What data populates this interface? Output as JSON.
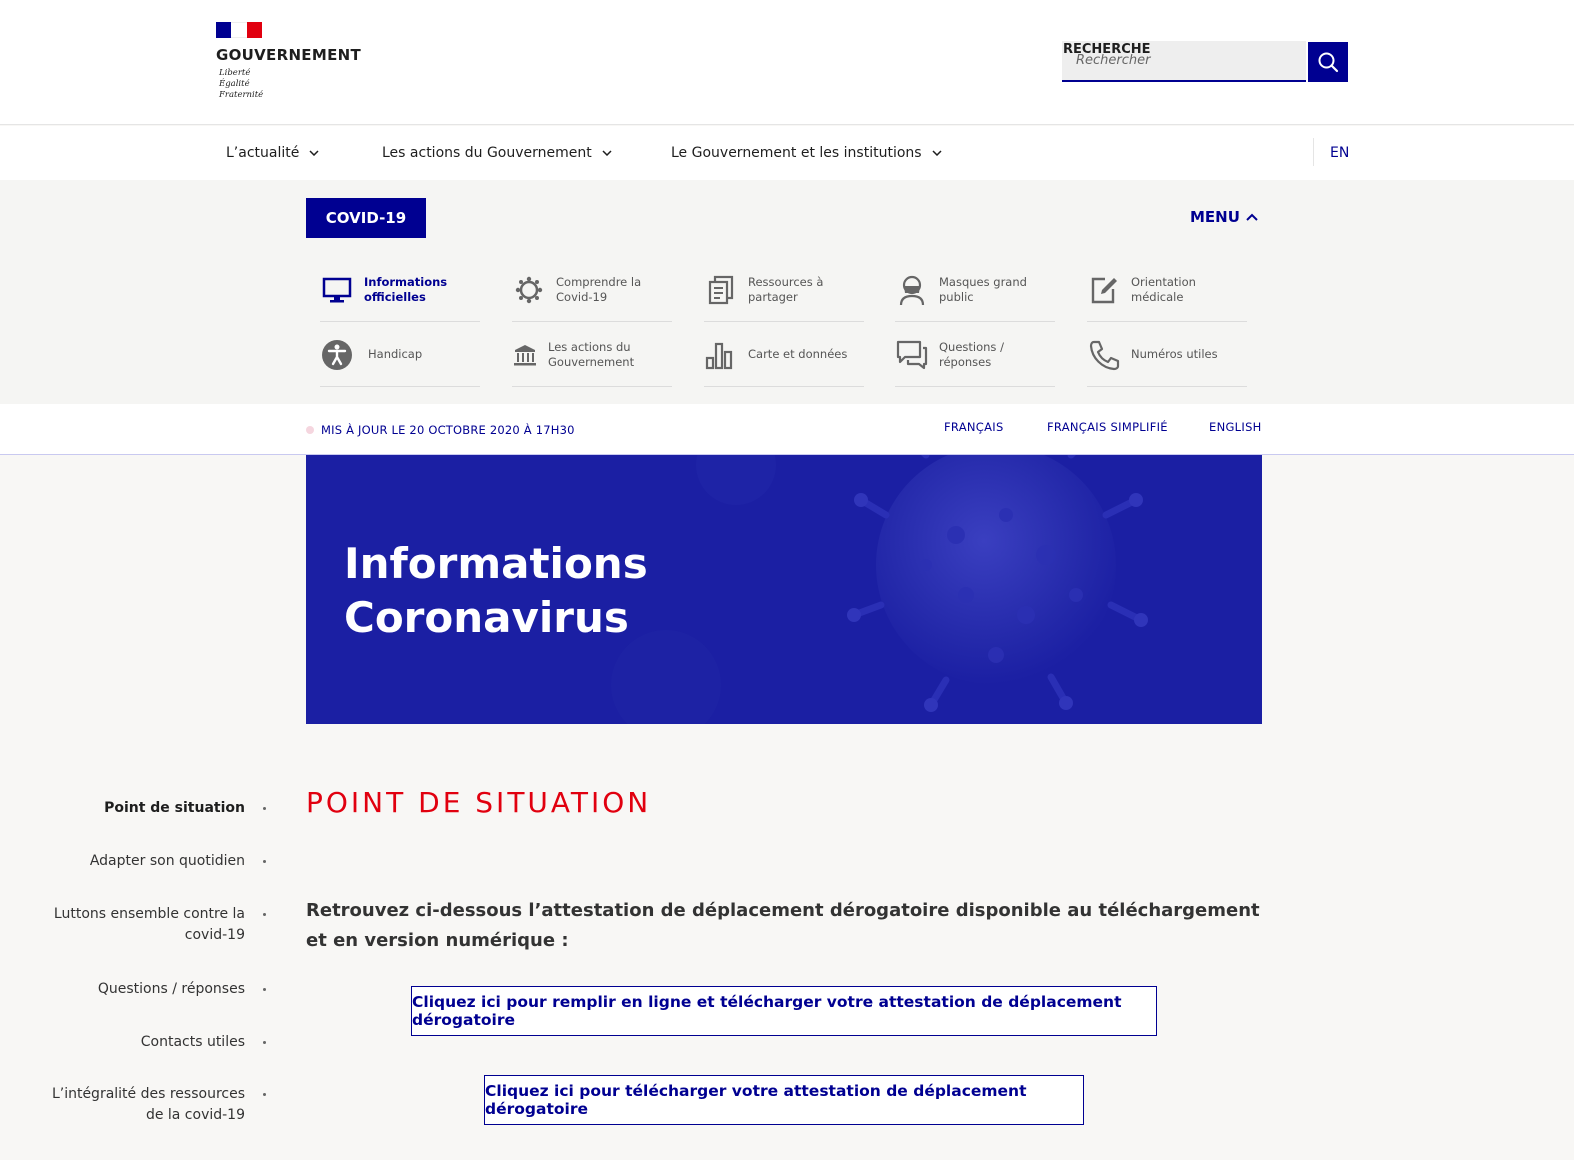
{
  "header": {
    "gov_name": "GOUVERNEMENT",
    "motto": [
      "Liberté",
      "Égalité",
      "Fraternité"
    ],
    "search_label": "RECHERCHE",
    "search_placeholder": "Rechercher",
    "search_button_icon": "search-icon"
  },
  "nav": {
    "items": [
      {
        "label": "L’actualité"
      },
      {
        "label": "Les actions du Gouvernement"
      },
      {
        "label": "Le Gouvernement et les institutions"
      }
    ],
    "lang": "EN"
  },
  "covid_menu": {
    "tag": "COVID-19",
    "toggle": "MENU",
    "tiles": [
      {
        "label": "Informations officielles",
        "icon": "monitor-icon",
        "active": true
      },
      {
        "label": "Comprendre la Covid-19",
        "icon": "virus-icon"
      },
      {
        "label": "Ressources à partager",
        "icon": "documents-icon"
      },
      {
        "label": "Masques grand public",
        "icon": "mask-icon"
      },
      {
        "label": "Orientation médicale",
        "icon": "edit-note-icon"
      },
      {
        "label": "Handicap",
        "icon": "accessibility-icon"
      },
      {
        "label": "Les actions du Gouvernement",
        "icon": "institution-icon"
      },
      {
        "label": "Carte et données",
        "icon": "bar-chart-icon"
      },
      {
        "label": "Questions / réponses",
        "icon": "chat-icon"
      },
      {
        "label": "Numéros utiles",
        "icon": "phone-icon"
      }
    ]
  },
  "update_bar": {
    "text": "MIS À JOUR LE 20 OCTOBRE 2020 À 17H30",
    "languages": [
      "FRANÇAIS",
      "FRANÇAIS SIMPLIFIÉ",
      "ENGLISH"
    ]
  },
  "hero": {
    "title_line1": "Informations",
    "title_line2": "Coronavirus"
  },
  "side_nav": [
    {
      "label": "Point de situation",
      "active": true
    },
    {
      "label": "Adapter son quotidien"
    },
    {
      "label": "Luttons ensemble contre la covid-19"
    },
    {
      "label": "Questions / réponses"
    },
    {
      "label": "Contacts utiles"
    },
    {
      "label": "L’intégralité des ressources de la covid-19"
    }
  ],
  "main": {
    "section_title": "POINT DE SITUATION",
    "intro": "Retrouvez ci-dessous l’attestation de déplacement dérogatoire disponible au téléchargement et en version numérique :",
    "cta_online": "Cliquez ici pour remplir en ligne et télécharger votre attestation de déplacement dérogatoire",
    "cta_download": "Cliquez ici pour télécharger votre attestation de déplacement dérogatoire"
  },
  "colors": {
    "brand_blue": "#000091",
    "marianne_red": "#e1000f",
    "hero_blue": "#1b1fa3"
  }
}
